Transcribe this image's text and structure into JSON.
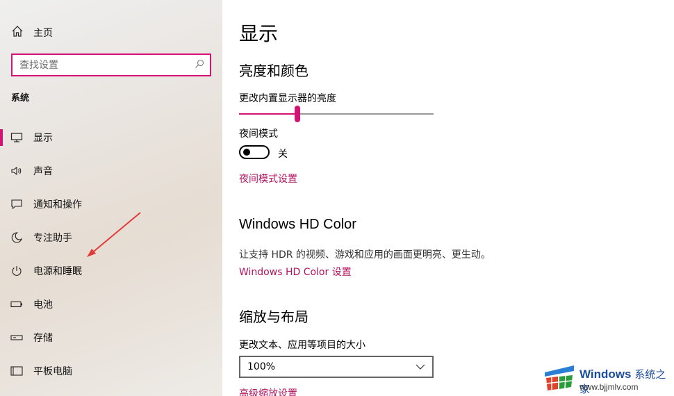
{
  "sidebar": {
    "home_label": "主页",
    "search_placeholder": "查找设置",
    "section_title": "系统",
    "items": [
      {
        "label": "显示",
        "icon": "monitor-icon",
        "selected": true
      },
      {
        "label": "声音",
        "icon": "speaker-icon",
        "selected": false
      },
      {
        "label": "通知和操作",
        "icon": "notification-icon",
        "selected": false
      },
      {
        "label": "专注助手",
        "icon": "moon-icon",
        "selected": false
      },
      {
        "label": "电源和睡眠",
        "icon": "power-icon",
        "selected": false
      },
      {
        "label": "电池",
        "icon": "battery-icon",
        "selected": false
      },
      {
        "label": "存储",
        "icon": "storage-icon",
        "selected": false
      },
      {
        "label": "平板电脑",
        "icon": "tablet-icon",
        "selected": false
      }
    ]
  },
  "main": {
    "title": "显示",
    "brightness": {
      "heading": "亮度和颜色",
      "label": "更改内置显示器的亮度",
      "value_fraction": 0.3
    },
    "night_mode": {
      "label": "夜间模式",
      "state": "关",
      "settings_link": "夜间模式设置"
    },
    "hdr": {
      "heading": "Windows HD Color",
      "description": "让支持 HDR 的视频、游戏和应用的画面更明亮、更生动。",
      "link": "Windows HD Color 设置"
    },
    "scale": {
      "heading": "缩放与布局",
      "label": "更改文本、应用等项目的大小",
      "value": "100%",
      "advanced_link": "高级缩放设置"
    }
  },
  "watermark": {
    "brand": "Windows",
    "brand_cn": "系统之家",
    "url": "www.bjjmlv.com"
  },
  "colors": {
    "accent": "#d41374",
    "link": "#b3135f"
  }
}
